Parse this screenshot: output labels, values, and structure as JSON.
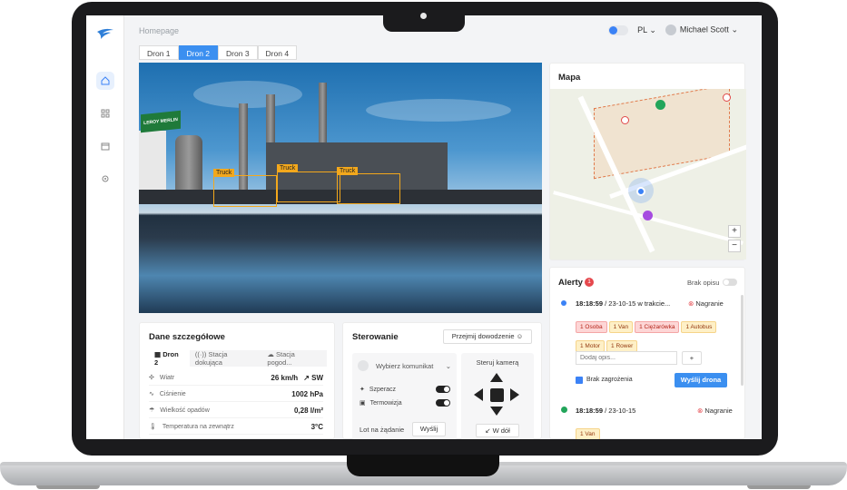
{
  "header": {
    "breadcrumb": "Homepage",
    "language": "PL",
    "user_name": "Michael Scott"
  },
  "tabs": [
    {
      "label": "Dron 1",
      "active": false
    },
    {
      "label": "Dron 2",
      "active": true
    },
    {
      "label": "Dron 3",
      "active": false
    },
    {
      "label": "Dron 4",
      "active": false
    }
  ],
  "video": {
    "detections": [
      "Truck",
      "Truck",
      "Truck"
    ],
    "signs": {
      "left": "LEROY MERLIN"
    }
  },
  "map": {
    "title": "Mapa",
    "zoom_in": "+",
    "zoom_out": "−"
  },
  "alerts": {
    "title": "Alerty",
    "count": "1",
    "toggle_label": "Brak opisu",
    "items": [
      {
        "time": "18:18:59",
        "meta": "/ 23-10-15 w trakcie...",
        "status": "Nagranie",
        "tags_red": [
          "1 Osoba",
          "1 Ciężarówka"
        ],
        "tags_yellow": [
          "1 Van",
          "1 Autobus",
          "1 Motor",
          "1 Rower"
        ],
        "input_placeholder": "Dodaj opis...",
        "add_label": "+",
        "checkbox_label": "Brak zagrożenia",
        "send_label": "Wyślij drona"
      },
      {
        "time": "18:18:59",
        "meta": "/ 23-10-15",
        "status": "Nagranie",
        "tags_yellow": [
          "1 Van"
        ]
      }
    ]
  },
  "details": {
    "title": "Dane szczegółowe",
    "tabs": [
      "Dron 2",
      "Stacja dokująca",
      "Stacja pogod..."
    ],
    "rows": [
      {
        "label": "Wiatr",
        "value": "26 km/h",
        "extra": "↗ SW"
      },
      {
        "label": "Ciśnienie",
        "value": "1002 hPa"
      },
      {
        "label": "Wielkość opadów",
        "value": "0,28 l/m²"
      },
      {
        "label": "Temperatura na zewnątrz",
        "value": "3°C"
      }
    ]
  },
  "control": {
    "title": "Sterowanie",
    "takeover_label": "Przejmij dowodzenie",
    "select_placeholder": "Wybierz komunikat",
    "toggles": [
      {
        "label": "Szperacz",
        "on": true
      },
      {
        "label": "Termowizja",
        "on": true
      }
    ],
    "on_demand_label": "Lot na żądanie",
    "send_label": "Wyślij",
    "camera_title": "Steruj kamerą",
    "down_label": "↙ W dół"
  }
}
